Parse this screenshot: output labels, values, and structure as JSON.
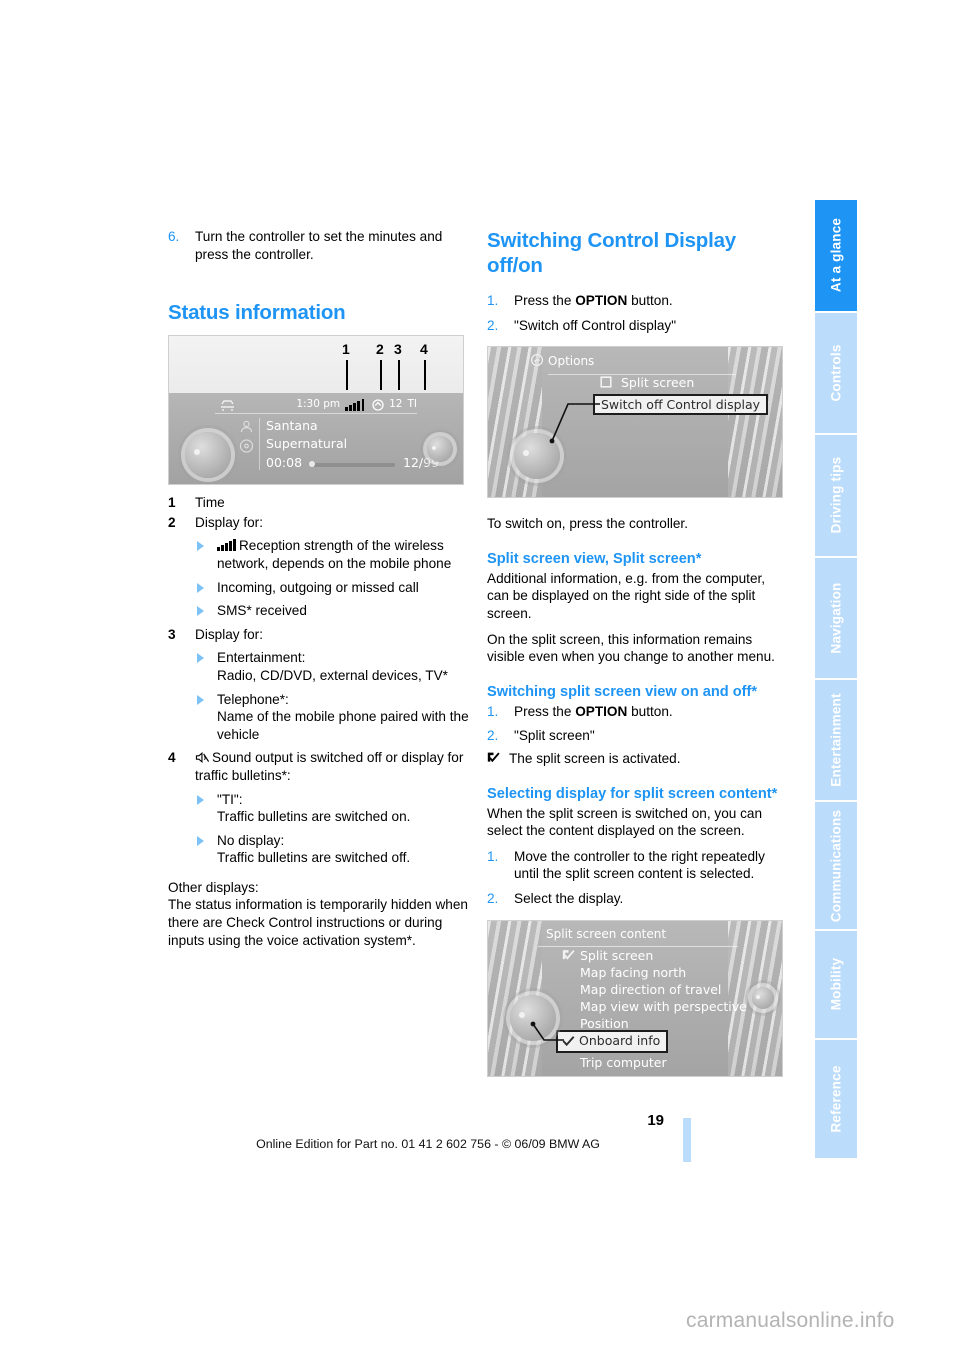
{
  "page": {
    "number": "19",
    "footer_line": "Online Edition for Part no. 01 41 2 602 756 - © 06/09 BMW AG",
    "watermark": "carmanualsonline.info",
    "accent_color": "#1e94f5",
    "tab_inactive_color": "#bcdcfb"
  },
  "sidebar": {
    "tabs": [
      {
        "label": "At a glance",
        "active": true
      },
      {
        "label": "Controls",
        "active": false
      },
      {
        "label": "Driving tips",
        "active": false
      },
      {
        "label": "Navigation",
        "active": false
      },
      {
        "label": "Entertainment",
        "active": false
      },
      {
        "label": "Communications",
        "active": false
      },
      {
        "label": "Mobility",
        "active": false
      },
      {
        "label": "Reference",
        "active": false
      }
    ]
  },
  "left_column": {
    "step6": {
      "num": "6.",
      "text": "Turn the controller to set the minutes and press the controller."
    },
    "heading": "Status information",
    "figure": {
      "caption_numbers": [
        "1",
        "2",
        "3",
        "4"
      ],
      "status_time": "1:30 pm",
      "status_items": [
        "12",
        "TI"
      ],
      "artist": "Santana",
      "track": "Supernatural",
      "elapsed": "00:08",
      "track_count": "12/99"
    },
    "legend": [
      {
        "num": "1",
        "text": "Time"
      },
      {
        "num": "2",
        "text": "Display for:"
      },
      {
        "num": "3",
        "text": "Display for:"
      },
      {
        "num": "4",
        "text": ""
      }
    ],
    "item2_bullets": [
      "Reception strength of the wireless network, depends on the mobile phone",
      "Incoming, outgoing or missed call",
      "SMS* received"
    ],
    "item3_bullets": [
      {
        "title": "Entertainment:",
        "detail": "Radio, CD/DVD, external devices, TV*"
      },
      {
        "title": "Telephone*:",
        "detail": "Name of the mobile phone paired with the vehicle"
      }
    ],
    "item4_text": "Sound output is switched off or display for traffic bulletins*:",
    "item4_bullets": [
      {
        "title": "\"TI\":",
        "detail": "Traffic bulletins are switched on."
      },
      {
        "title": "No display:",
        "detail": "Traffic bulletins are switched off."
      }
    ],
    "other_displays_label": "Other displays:",
    "other_displays_text": "The status information is temporarily hidden when there are Check Control instructions or during inputs using the voice activation system*."
  },
  "right_column": {
    "heading1": "Switching Control Display off/on",
    "steps1": [
      {
        "num": "1.",
        "pre": "Press the ",
        "bold": "OPTION",
        "post": " button."
      },
      {
        "num": "2.",
        "pre": "\"Switch off Control display\"",
        "bold": "",
        "post": ""
      }
    ],
    "figure_options": {
      "title": "Options",
      "items": [
        "Split screen",
        "Switch off Control display"
      ],
      "highlighted": "Switch off Control display"
    },
    "after_fig1": "To switch on, press the controller.",
    "heading2": "Split screen view, Split screen*",
    "para1": "Additional information, e.g. from the computer, can be displayed on the right side of the split screen.",
    "para2": "On the split screen, this information remains visible even when you change to another menu.",
    "heading3": "Switching split screen view on and off*",
    "steps2": [
      {
        "num": "1.",
        "pre": "Press the ",
        "bold": "OPTION",
        "post": " button."
      },
      {
        "num": "2.",
        "pre": "\"Split screen\"",
        "bold": "",
        "post": ""
      }
    ],
    "result": "The split screen is activated.",
    "heading4": "Selecting display for split screen content*",
    "para3": "When the split screen is switched on, you can select the content displayed on the screen.",
    "steps3": [
      {
        "num": "1.",
        "pre": "Move the controller to the right repeatedly until the split screen content is selected.",
        "bold": "",
        "post": ""
      },
      {
        "num": "2.",
        "pre": "Select the display.",
        "bold": "",
        "post": ""
      }
    ],
    "figure_split": {
      "title": "Split screen content",
      "items": [
        "Split screen",
        "Map facing north",
        "Map direction of travel",
        "Map view with perspective",
        "Position",
        "Onboard info",
        "Trip computer"
      ],
      "checked": "Split screen",
      "highlighted": "Onboard info"
    }
  }
}
